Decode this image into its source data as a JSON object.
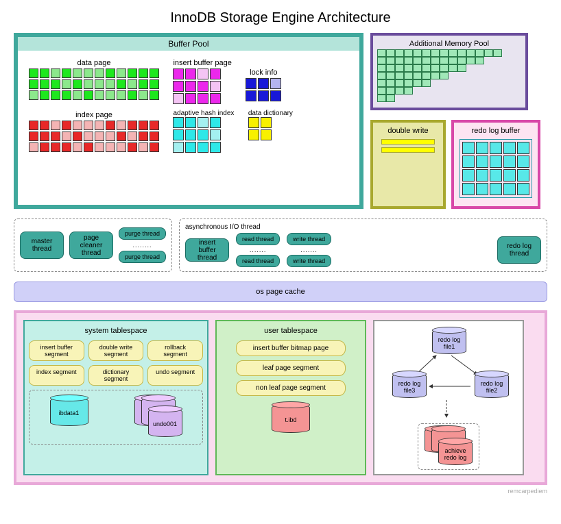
{
  "title": "InnoDB Storage Engine Architecture",
  "buffer_pool": {
    "title": "Buffer Pool",
    "data_page": {
      "label": "data page",
      "rows": 3,
      "cols": 12,
      "color1": "#8ce88c",
      "color2": "#1ee81e"
    },
    "insert_buffer_page": {
      "label": "insert buffer page",
      "rows": 3,
      "cols": 4,
      "color1": "#f4c4f4",
      "color2": "#ec28ec"
    },
    "lock_info": {
      "label": "lock info",
      "rows": 2,
      "cols": 3,
      "color1": "#b4b4f0",
      "color2": "#1818d8"
    },
    "index_page": {
      "label": "index page",
      "rows": 3,
      "cols": 12,
      "color1": "#f4b4b4",
      "color2": "#e82828"
    },
    "adaptive_hash": {
      "label": "adaptive hash index",
      "rows": 3,
      "cols": 4,
      "color1": "#a4f0f0",
      "color2": "#2ee8e8"
    },
    "data_dict": {
      "label": "data dictionary",
      "rows": 2,
      "cols": 2,
      "color1": "#f8f49c",
      "color2": "#f8f000"
    }
  },
  "amp": {
    "title": "Additional Memory Pool",
    "rows": [
      14,
      12,
      10,
      8,
      6,
      4,
      2
    ],
    "color": "#a0e8b8"
  },
  "double_write": {
    "title": "double write"
  },
  "redo_log_buffer": {
    "title": "redo log buffer",
    "rows": 4,
    "cols": 5,
    "color": "#58e8e8"
  },
  "threads": {
    "left": [
      "master thread",
      "page cleaner thread"
    ],
    "purge": [
      "purge thread",
      "........",
      "purge thread"
    ],
    "async_title": "asynchronous I/O thread",
    "insert_buffer": "insert buffer thread",
    "read": [
      "read thread",
      ".......",
      "read thread"
    ],
    "write": [
      "write thread",
      ".......",
      "write thread"
    ],
    "redo": "redo log thread"
  },
  "os_cache": "os page cache",
  "bottom": {
    "system_ts": {
      "title": "system tablespace",
      "segments": [
        "insert buffer segment",
        "double write segment",
        "rollback segment",
        "index segment",
        "dictionary segment",
        "undo segment"
      ],
      "cylinders": [
        "ibdata1",
        "undo001"
      ]
    },
    "user_ts": {
      "title": "user tablespace",
      "pages": [
        "insert buffer bitmap page",
        "leaf page segment",
        "non leaf page segment"
      ],
      "cylinder": "t.ibd"
    },
    "redo": {
      "files": [
        "redo log file1",
        "redo log file2",
        "redo log file3"
      ],
      "archive": "achieve redo log"
    }
  },
  "watermark": "remcarpediem"
}
